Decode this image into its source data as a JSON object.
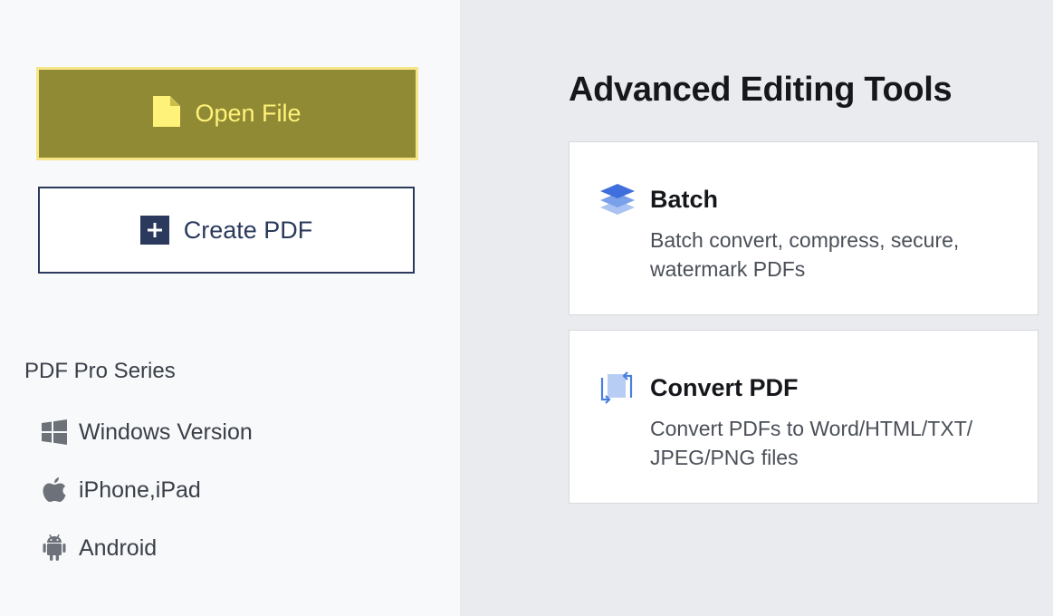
{
  "sidebar": {
    "open_file_label": "Open File",
    "create_pdf_label": "Create PDF",
    "series_title": "PDF Pro Series",
    "series_items": [
      {
        "label": "Windows Version",
        "icon": "windows-icon"
      },
      {
        "label": "iPhone,iPad",
        "icon": "apple-icon"
      },
      {
        "label": "Android",
        "icon": "android-icon"
      }
    ]
  },
  "main": {
    "title": "Advanced Editing Tools",
    "cards": [
      {
        "title": "Batch",
        "description": "Batch convert, compress, secure, watermark PDFs",
        "icon": "layers-icon"
      },
      {
        "title": "Convert PDF",
        "description": "Convert PDFs to Word/HTML/TXT/ JPEG/PNG files",
        "icon": "convert-icon"
      }
    ]
  },
  "colors": {
    "open_button_bg": "#8f8a33",
    "open_button_text": "#fff27a",
    "open_button_border": "#f7e58a",
    "create_button_border": "#2b3a5c",
    "accent_blue": "#4a7fe0"
  }
}
